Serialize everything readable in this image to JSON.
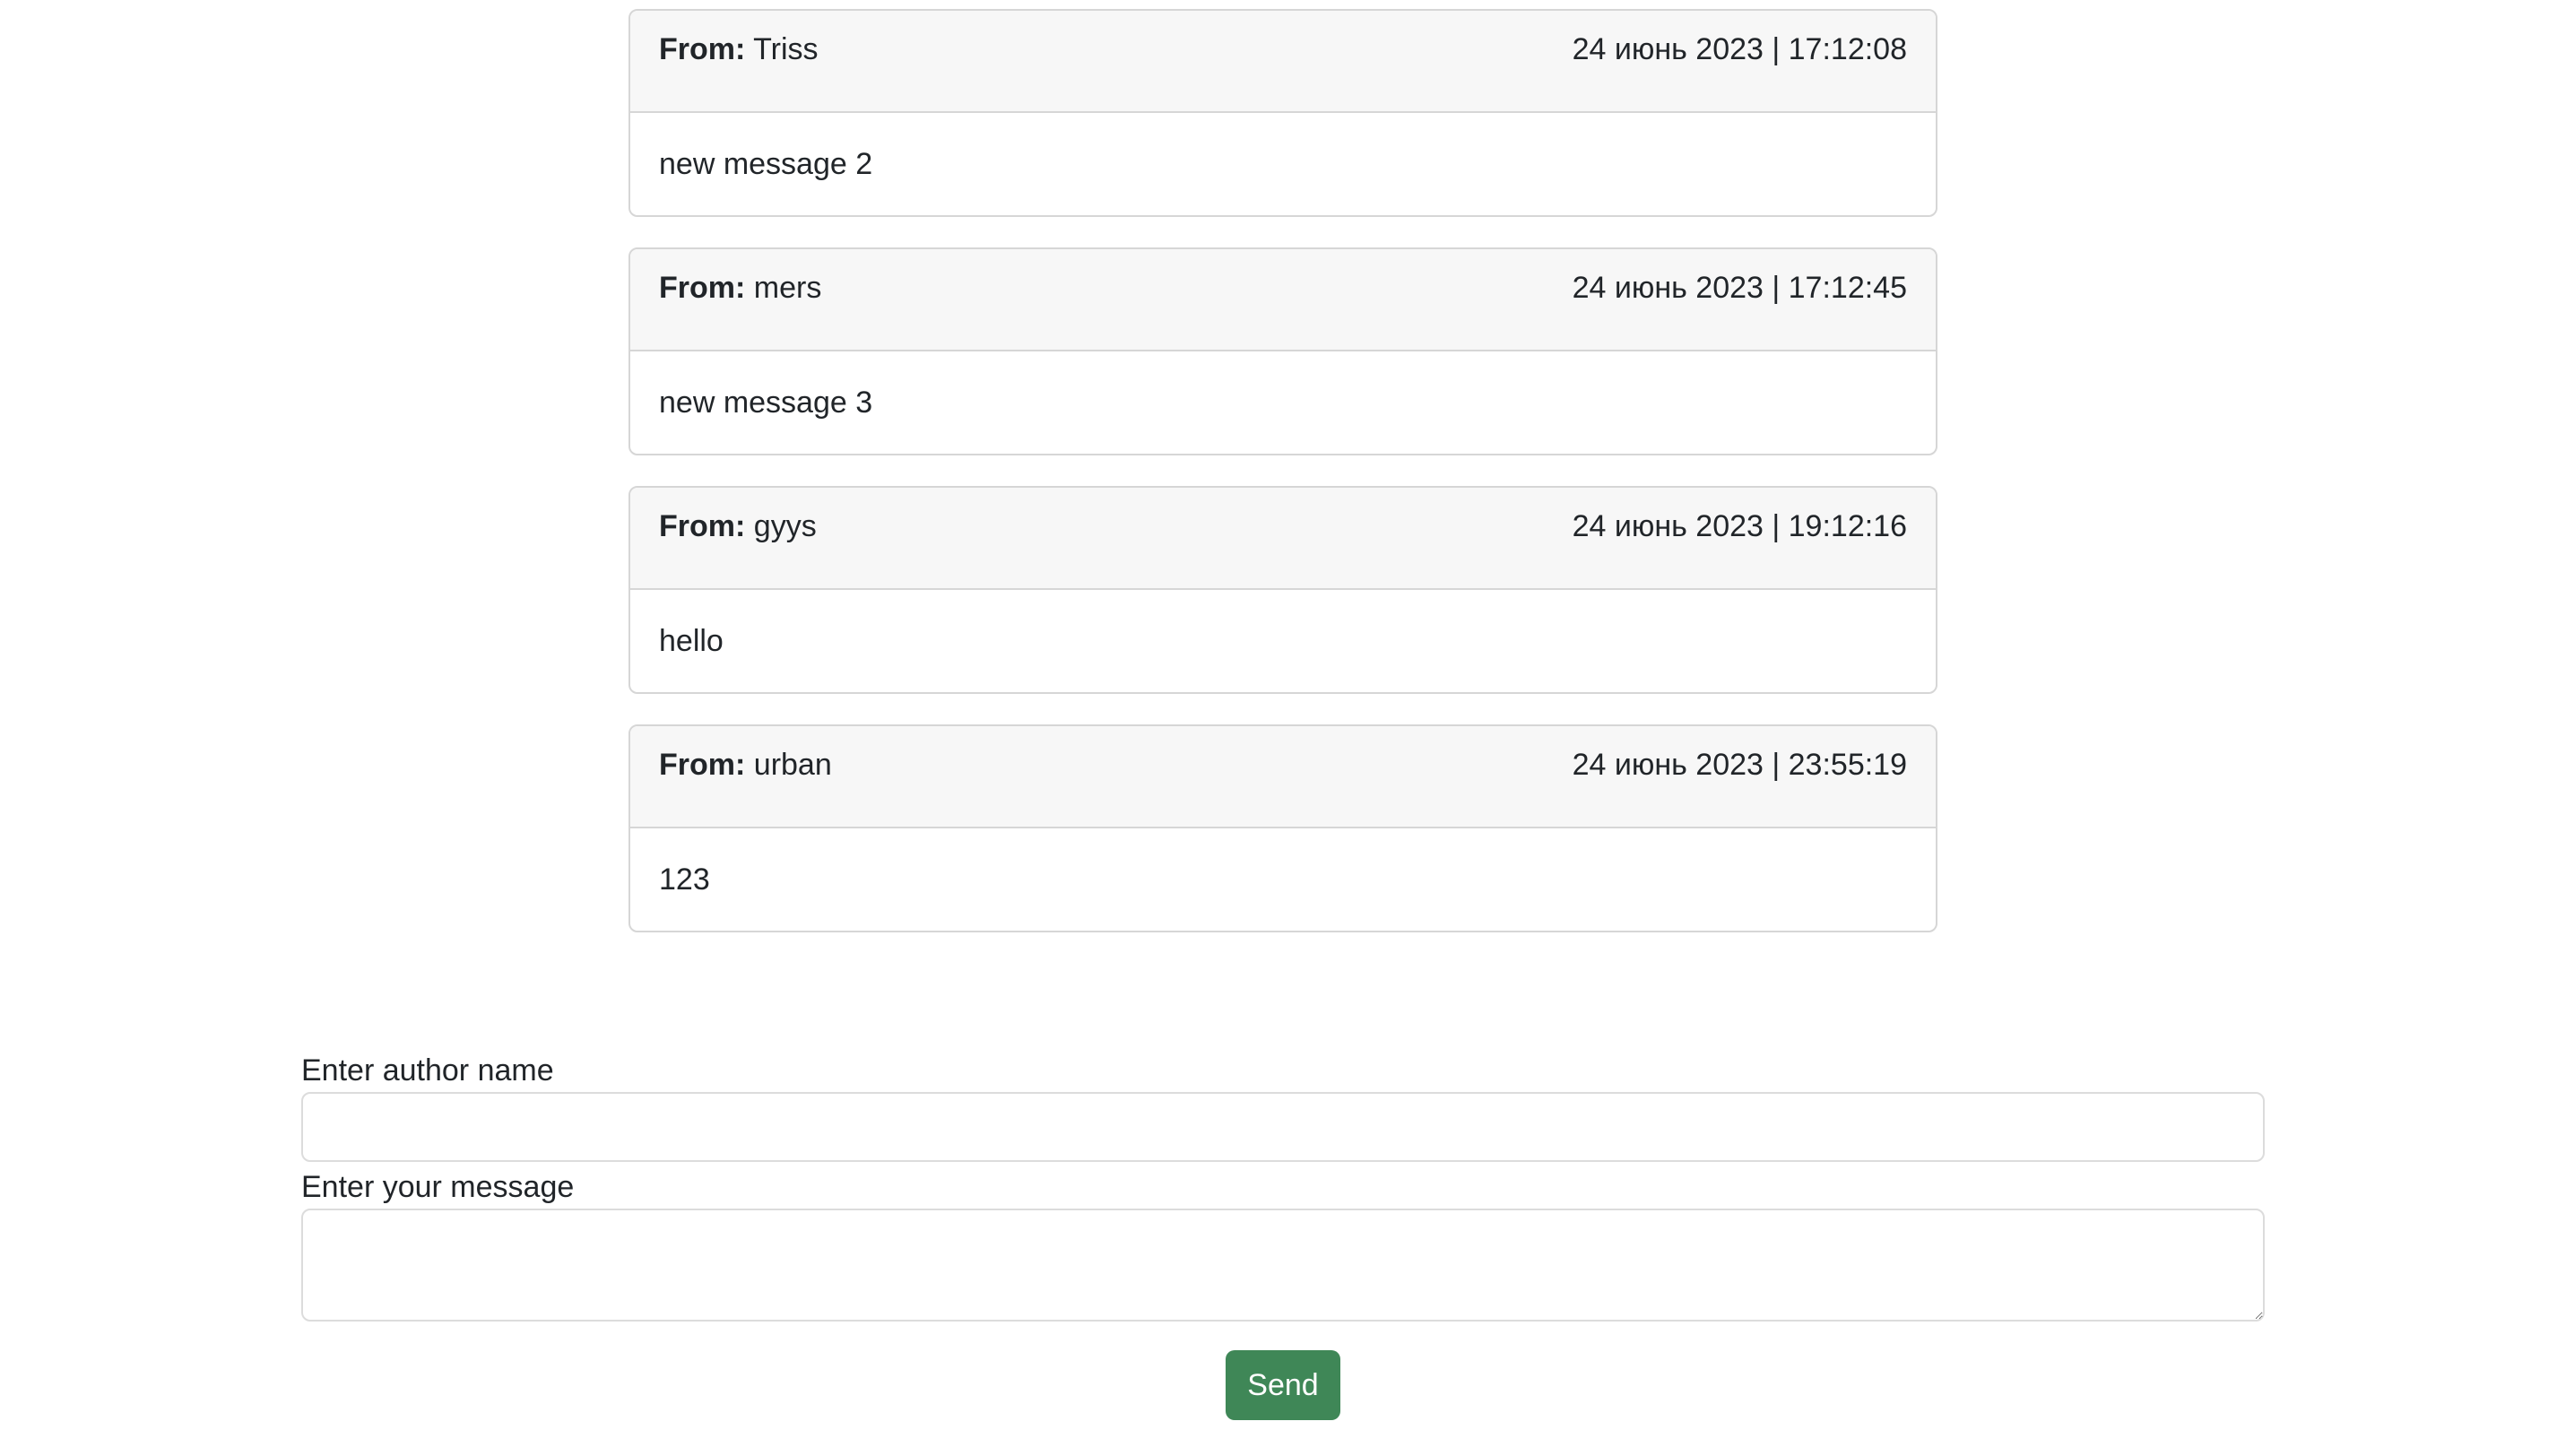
{
  "messages": [
    {
      "from_label": "From:",
      "author": "Triss",
      "timestamp": "24 июнь 2023 | 17:12:08",
      "text": "new message 2"
    },
    {
      "from_label": "From:",
      "author": "mers",
      "timestamp": "24 июнь 2023 | 17:12:45",
      "text": "new message 3"
    },
    {
      "from_label": "From:",
      "author": "gyys",
      "timestamp": "24 июнь 2023 | 19:12:16",
      "text": "hello"
    },
    {
      "from_label": "From:",
      "author": "urban",
      "timestamp": "24 июнь 2023 | 23:55:19",
      "text": "123"
    }
  ],
  "form": {
    "author_label": "Enter author name",
    "author_value": "",
    "message_label": "Enter your message",
    "message_value": "",
    "send_label": "Send"
  },
  "colors": {
    "send_button": "#3f8757",
    "card_header_bg": "#f7f7f7",
    "border": "#d6d6d6"
  }
}
